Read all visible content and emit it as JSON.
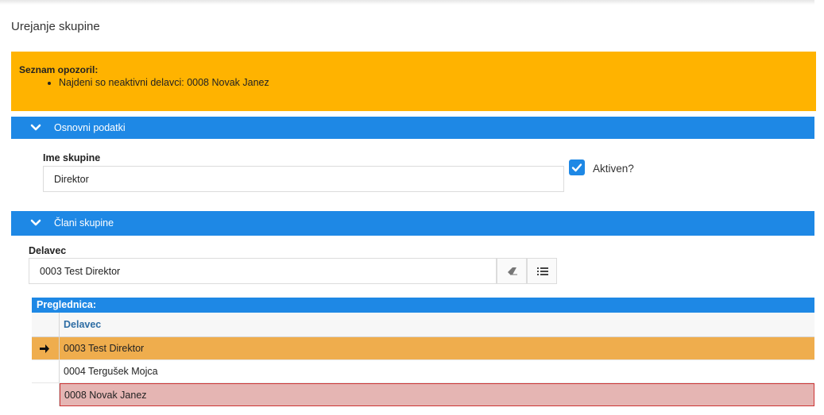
{
  "page": {
    "title": "Urejanje skupine"
  },
  "warnings": {
    "title": "Seznam opozoril:",
    "items": [
      "Najdeni so neaktivni delavci: 0008 Novak Janez"
    ],
    "color": "#ffb300"
  },
  "section_basic": {
    "label": "Osnovni podatki"
  },
  "group_name": {
    "label": "Ime skupine",
    "value": "Direktor"
  },
  "active": {
    "label": "Aktiven?",
    "checked": true
  },
  "section_members": {
    "label": "Člani skupine"
  },
  "worker": {
    "label": "Delavec",
    "value": "0003 Test Direktor",
    "clear_icon": "eraser-icon",
    "list_icon": "list-icon"
  },
  "grid": {
    "title": "Preglednica:",
    "column": "Delavec",
    "rows": [
      {
        "value": "0003 Test Direktor",
        "state": "selected"
      },
      {
        "value": "0004 Tergušek Mojca",
        "state": "normal"
      },
      {
        "value": "0008 Novak Janez",
        "state": "inactive"
      }
    ]
  },
  "colors": {
    "accent": "#1e88e5",
    "selected_row": "#efad4d",
    "inactive_row": "#e5b5b3"
  }
}
